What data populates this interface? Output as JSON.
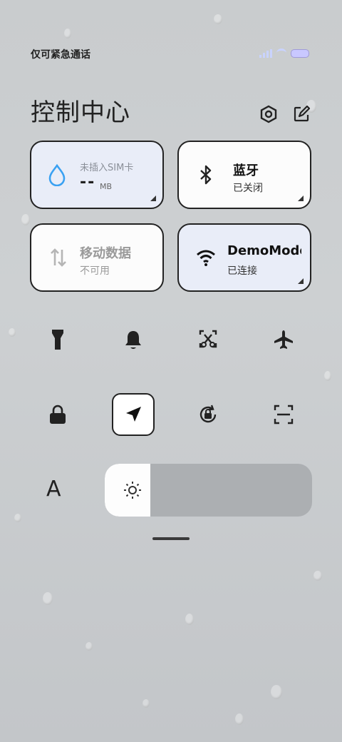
{
  "status_bar": {
    "carrier_text": "仅可紧急通话"
  },
  "header": {
    "title": "控制中心",
    "settings_icon": "settings-hex-icon",
    "edit_icon": "edit-icon"
  },
  "tiles": {
    "data_usage": {
      "label": "未插入SIM卡",
      "value": "--",
      "unit": "MB",
      "icon": "water-drop-icon",
      "accent": "#3aa1f2"
    },
    "bluetooth": {
      "title": "蓝牙",
      "status": "已关闭",
      "icon": "bluetooth-icon"
    },
    "mobile_data": {
      "title": "移动数据",
      "status": "不可用",
      "icon": "data-arrows-icon"
    },
    "wifi": {
      "title": "DemoMode",
      "status": "已连接",
      "icon": "wifi-icon"
    }
  },
  "toggles_row1": [
    "flashlight-icon",
    "bell-icon",
    "screenshot-icon",
    "airplane-icon"
  ],
  "toggles_row2": [
    "lock-icon",
    "location-arrow-icon",
    "rotation-lock-icon",
    "scan-icon"
  ],
  "font_label": "A",
  "brightness": {
    "level_percent": 22
  }
}
